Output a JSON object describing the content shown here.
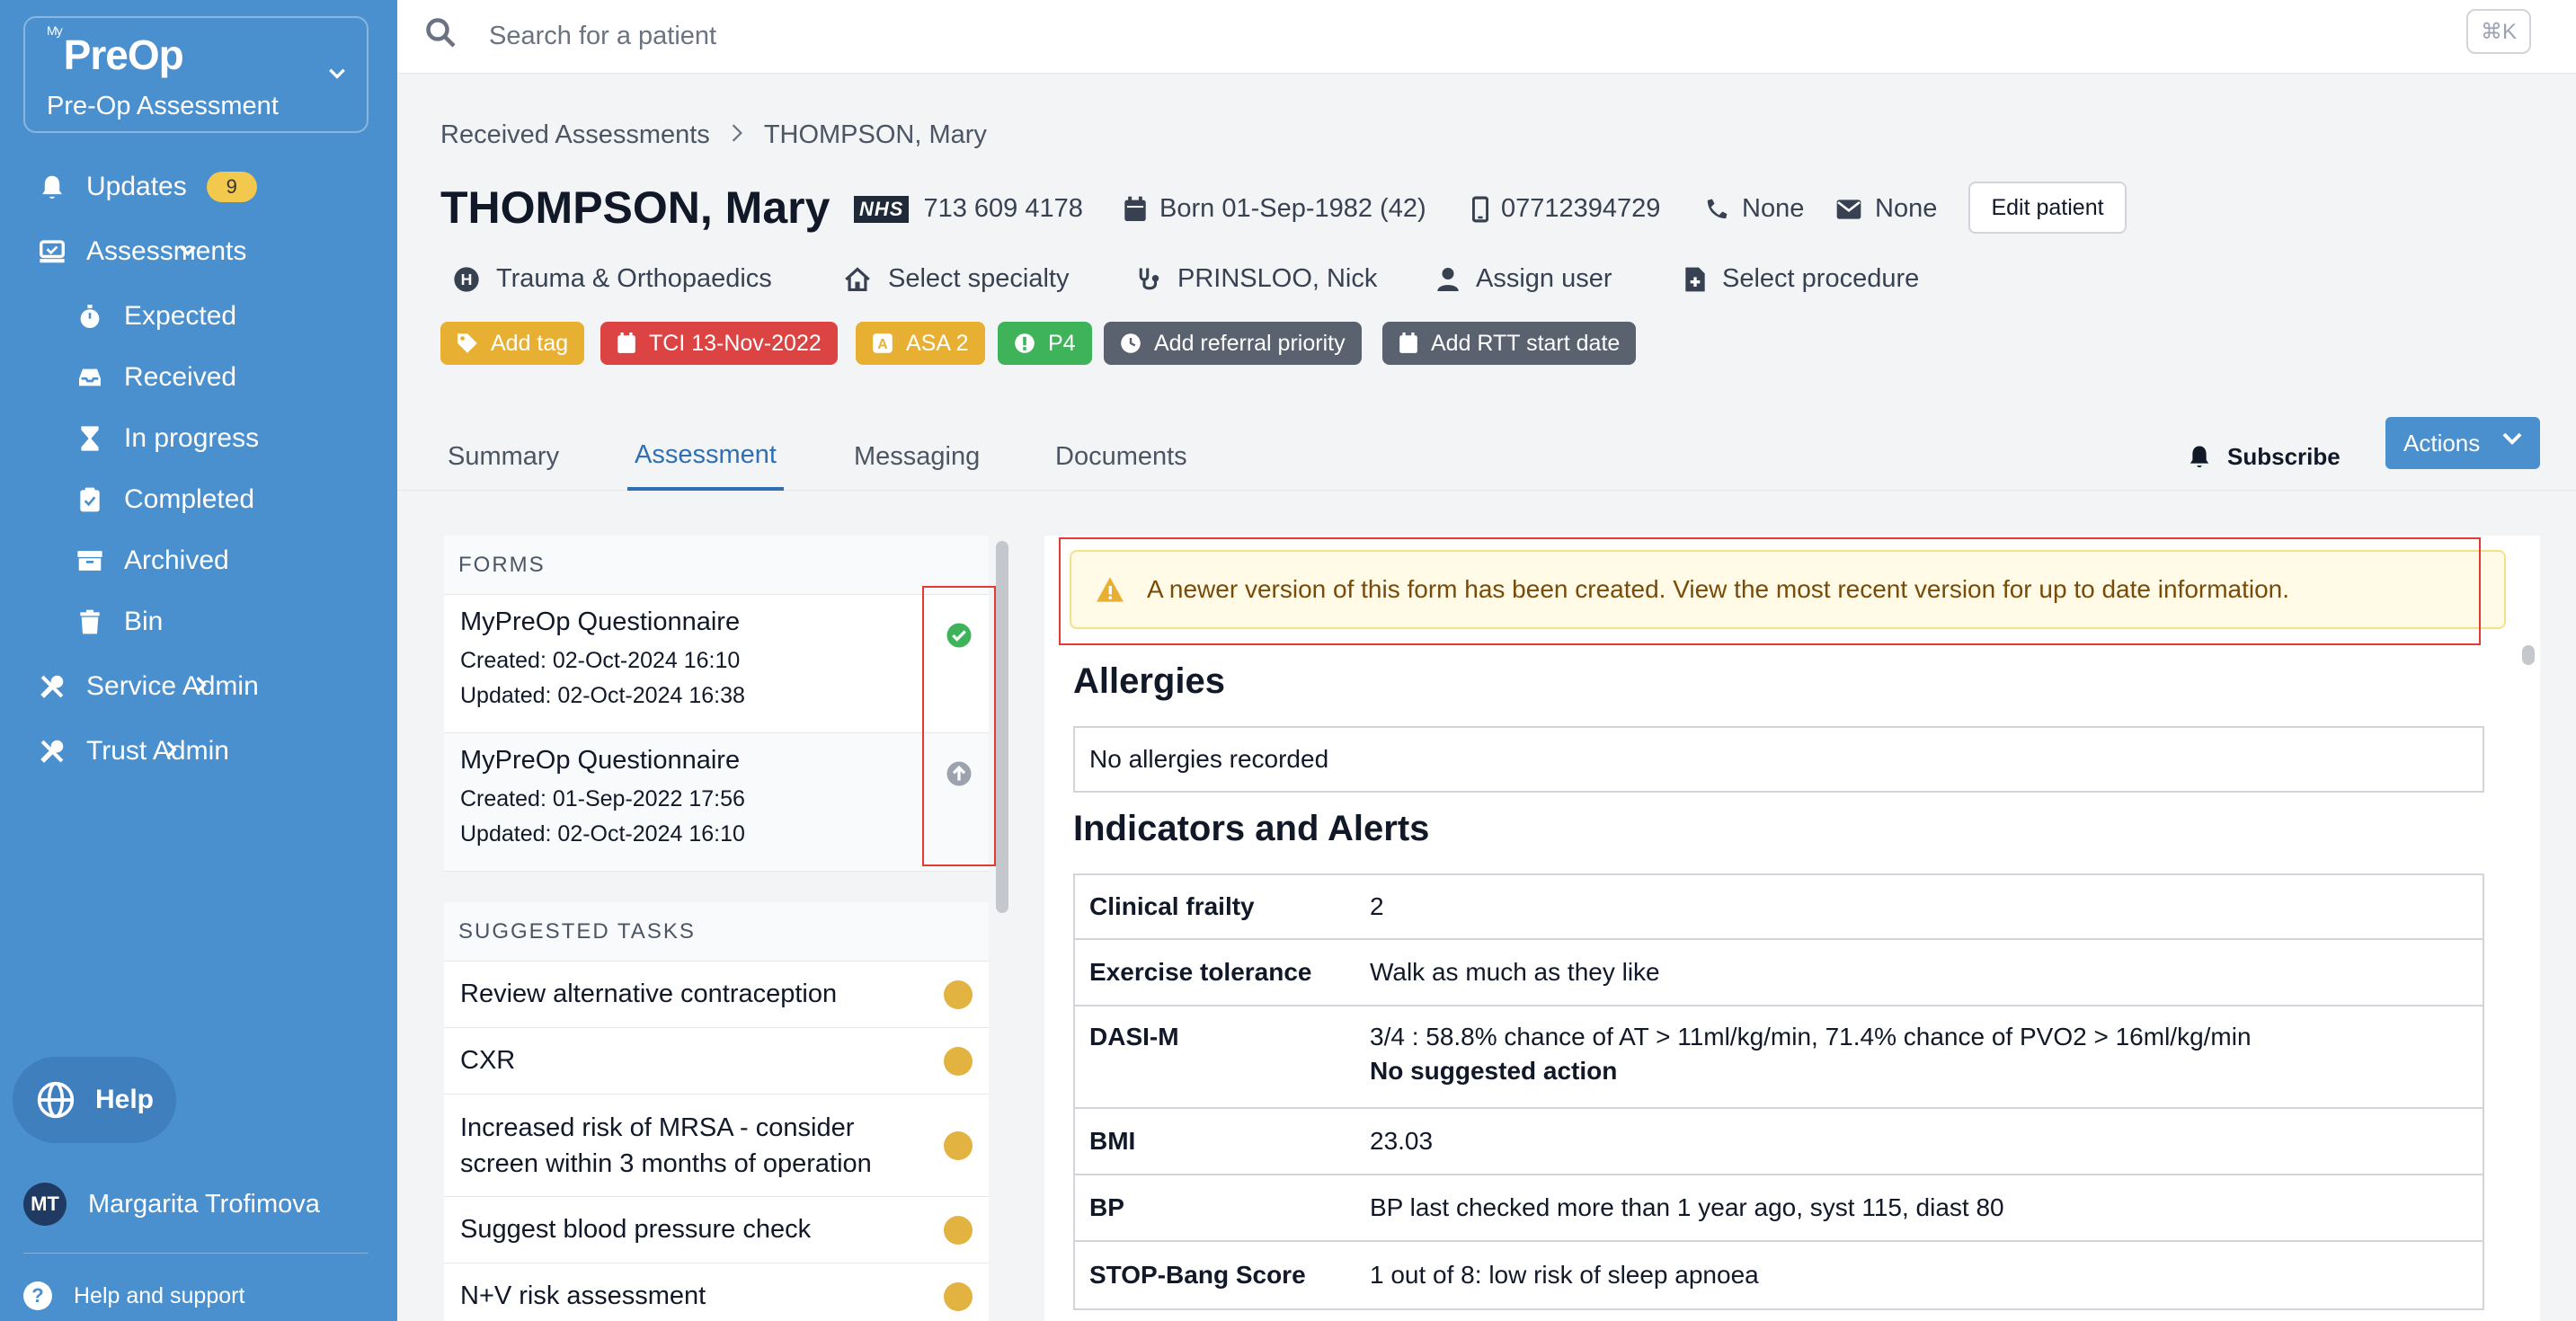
{
  "sidebar": {
    "brand_my": "My",
    "brand_logo": "PreOp",
    "brand_sub": "Pre-Op Assessment",
    "updates_label": "Updates",
    "updates_count": "9",
    "assessments_label": "Assessments",
    "sub_items": [
      "Expected",
      "Received",
      "In progress",
      "Completed",
      "Archived",
      "Bin"
    ],
    "service_admin": "Service Admin",
    "trust_admin": "Trust Admin",
    "help_label": "Help",
    "user_initials": "MT",
    "user_name": "Margarita Trofimova",
    "support_label": "Help and support"
  },
  "search": {
    "placeholder": "Search for a patient",
    "shortcut": "⌘K"
  },
  "breadcrumb": {
    "parent": "Received Assessments",
    "current": "THOMPSON, Mary"
  },
  "patient": {
    "name": "THOMPSON, Mary",
    "nhs_logo": "NHS",
    "nhs_number": "713 609 4178",
    "born": "Born 01-Sep-1982 (42)",
    "mobile": "07712394729",
    "phone": "None",
    "email": "None",
    "edit_label": "Edit patient",
    "department": "Trauma & Orthopaedics",
    "specialty": "Select specialty",
    "clinician": "PRINSLOO, Nick",
    "assign_user": "Assign user",
    "procedure": "Select procedure"
  },
  "tags": {
    "add_tag": "Add tag",
    "tci": "TCI 13-Nov-2022",
    "asa": "ASA 2",
    "p4": "P4",
    "referral": "Add referral priority",
    "rtt": "Add RTT start date"
  },
  "tabs": [
    "Summary",
    "Assessment",
    "Messaging",
    "Documents"
  ],
  "subscribe_label": "Subscribe",
  "actions_label": "Actions",
  "forms": {
    "heading": "FORMS",
    "items": [
      {
        "title": "MyPreOp Questionnaire",
        "created": "Created: 02-Oct-2024 16:10",
        "updated": "Updated: 02-Oct-2024 16:38"
      },
      {
        "title": "MyPreOp Questionnaire",
        "created": "Created: 01-Sep-2022 17:56",
        "updated": "Updated: 02-Oct-2024 16:10"
      }
    ]
  },
  "tasks": {
    "heading": "SUGGESTED TASKS",
    "items": [
      {
        "line1": "Review alternative contraception",
        "line2": ""
      },
      {
        "line1": "CXR",
        "line2": ""
      },
      {
        "line1": "Increased risk of MRSA - consider",
        "line2": "screen within 3 months of operation"
      },
      {
        "line1": "Suggest blood pressure check",
        "line2": ""
      },
      {
        "line1": "N+V risk assessment",
        "line2": ""
      }
    ]
  },
  "alert_text": "A newer version of this form has been created. View the most recent version for up to date information.",
  "allergies": {
    "heading": "Allergies",
    "text": "No allergies recorded"
  },
  "indicators": {
    "heading": "Indicators and Alerts",
    "rows": [
      {
        "key": "Clinical frailty",
        "value": "2",
        "value2": ""
      },
      {
        "key": "Exercise tolerance",
        "value": "Walk as much as they like",
        "value2": ""
      },
      {
        "key": "DASI-M",
        "value": "3/4 : 58.8% chance of AT > 11ml/kg/min, 71.4% chance of PVO2 > 16ml/kg/min",
        "value2": "No suggested action"
      },
      {
        "key": "BMI",
        "value": "23.03",
        "value2": ""
      },
      {
        "key": "BP",
        "value": "BP last checked more than 1 year ago, syst 115, diast 80",
        "value2": ""
      },
      {
        "key": "STOP-Bang Score",
        "value": "1 out of 8: low risk of sleep apnoea",
        "value2": ""
      }
    ]
  }
}
